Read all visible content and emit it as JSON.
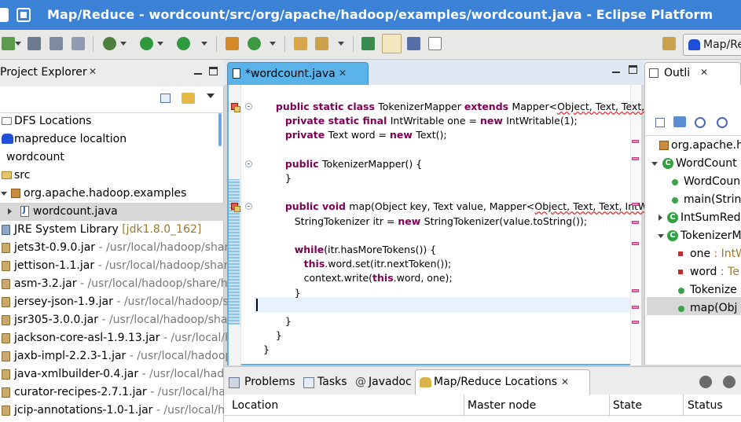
{
  "window": {
    "title": "Map/Reduce - wordcount/src/org/apache/hadoop/examples/wordcount.java - Eclipse Platform"
  },
  "perspective": {
    "label": "Map/Re"
  },
  "project_explorer": {
    "title": "Project Explorer",
    "items": [
      {
        "label": "DFS Locations",
        "path": ""
      },
      {
        "label": "mapreduce  localtion",
        "path": ""
      },
      {
        "label": "wordcount",
        "path": ""
      },
      {
        "label": "src",
        "path": ""
      },
      {
        "label": "org.apache.hadoop.examples",
        "path": ""
      },
      {
        "label": "wordcount.java",
        "path": ""
      },
      {
        "label": "JRE System Library ",
        "path": "[jdk1.8.0_162]"
      },
      {
        "label": "jets3t-0.9.0.jar",
        "path": " - /usr/local/hadoop/share"
      },
      {
        "label": "jettison-1.1.jar",
        "path": " - /usr/local/hadoop/share"
      },
      {
        "label": "asm-3.2.jar",
        "path": " - /usr/local/hadoop/share/h"
      },
      {
        "label": "jersey-json-1.9.jar",
        "path": " - /usr/local/hadoop/s"
      },
      {
        "label": "jsr305-3.0.0.jar",
        "path": " - /usr/local/hadoop/shar"
      },
      {
        "label": "jackson-core-asl-1.9.13.jar",
        "path": " - /usr/local/h"
      },
      {
        "label": "jaxb-impl-2.2.3-1.jar",
        "path": " - /usr/local/hadoop"
      },
      {
        "label": "java-xmlbuilder-0.4.jar",
        "path": " - /usr/local/hado"
      },
      {
        "label": "curator-recipes-2.7.1.jar",
        "path": " - /usr/local/hac"
      },
      {
        "label": "jcip-annotations-1.0-1.jar",
        "path": " - /usr/local/ha"
      }
    ]
  },
  "editor": {
    "tab_label": "*wordcount.java",
    "lines": [
      {
        "indent": "    ",
        "parts": [
          [
            "kw",
            "public static class "
          ],
          [
            "",
            "TokenizerMapper "
          ],
          [
            "kw",
            "extends "
          ],
          [
            "",
            "Mapper<"
          ],
          [
            "sq",
            "Object, Text, Text, IntW"
          ]
        ]
      },
      {
        "indent": "       ",
        "parts": [
          [
            "kw",
            "private static final "
          ],
          [
            "",
            "IntWritable one = "
          ],
          [
            "kw",
            "new "
          ],
          [
            "",
            "IntWritable(1);"
          ]
        ]
      },
      {
        "indent": "       ",
        "parts": [
          [
            "kw",
            "private "
          ],
          [
            "",
            "Text word = "
          ],
          [
            "kw",
            "new "
          ],
          [
            "",
            "Text();"
          ]
        ]
      },
      {
        "indent": "",
        "parts": []
      },
      {
        "indent": "       ",
        "parts": [
          [
            "kw",
            "public "
          ],
          [
            "",
            "TokenizerMapper() {"
          ]
        ]
      },
      {
        "indent": "       ",
        "parts": [
          [
            "",
            "}"
          ]
        ]
      },
      {
        "indent": "",
        "parts": []
      },
      {
        "indent": "       ",
        "parts": [
          [
            "kw",
            "public void "
          ],
          [
            "",
            "map(Object key, Text value, Mapper<"
          ],
          [
            "sq",
            "Object, Text, Text, IntWritab"
          ]
        ]
      },
      {
        "indent": "          ",
        "parts": [
          [
            "",
            "StringTokenizer itr = "
          ],
          [
            "kw",
            "new "
          ],
          [
            "",
            "StringTokenizer(value.toString());"
          ]
        ]
      },
      {
        "indent": "",
        "parts": []
      },
      {
        "indent": "          ",
        "parts": [
          [
            "kw",
            "while"
          ],
          [
            "",
            "(itr.hasMoreTokens()) {"
          ]
        ]
      },
      {
        "indent": "             ",
        "parts": [
          [
            "kw",
            "this"
          ],
          [
            "",
            ".word.set(itr.nextToken());"
          ]
        ]
      },
      {
        "indent": "             ",
        "parts": [
          [
            "",
            "context.write("
          ],
          [
            "kw",
            "this"
          ],
          [
            "",
            ".word, one);"
          ]
        ]
      },
      {
        "indent": "          ",
        "parts": [
          [
            "",
            "}"
          ]
        ]
      },
      {
        "indent": "",
        "parts": []
      },
      {
        "indent": "       ",
        "parts": [
          [
            "",
            "}"
          ]
        ]
      },
      {
        "indent": "    ",
        "parts": [
          [
            "",
            "}"
          ]
        ]
      },
      {
        "indent": "",
        "parts": [
          [
            "",
            "}"
          ]
        ]
      }
    ]
  },
  "outline": {
    "title": "Outli",
    "items": [
      {
        "label": "org.apache.h"
      },
      {
        "label": "WordCount"
      },
      {
        "label": "WordCoun"
      },
      {
        "label": "main(Strin"
      },
      {
        "label": "IntSumRed"
      },
      {
        "label": "TokenizerM"
      },
      {
        "label": "one : IntW",
        "main": "one",
        "type": " : IntW"
      },
      {
        "label": "word : Te",
        "main": "word",
        "type": " : Te"
      },
      {
        "label": "Tokenize"
      },
      {
        "label": "map(Obj"
      }
    ]
  },
  "bottom": {
    "tabs": [
      "Problems",
      "Tasks",
      "Javadoc",
      "Map/Reduce Locations"
    ],
    "columns": [
      "Location",
      "Master node",
      "State",
      "Status"
    ]
  },
  "colors": {
    "titlebar": "#3b82d6",
    "keyword": "#7f0055",
    "editor_border": "#5ab3e8"
  }
}
